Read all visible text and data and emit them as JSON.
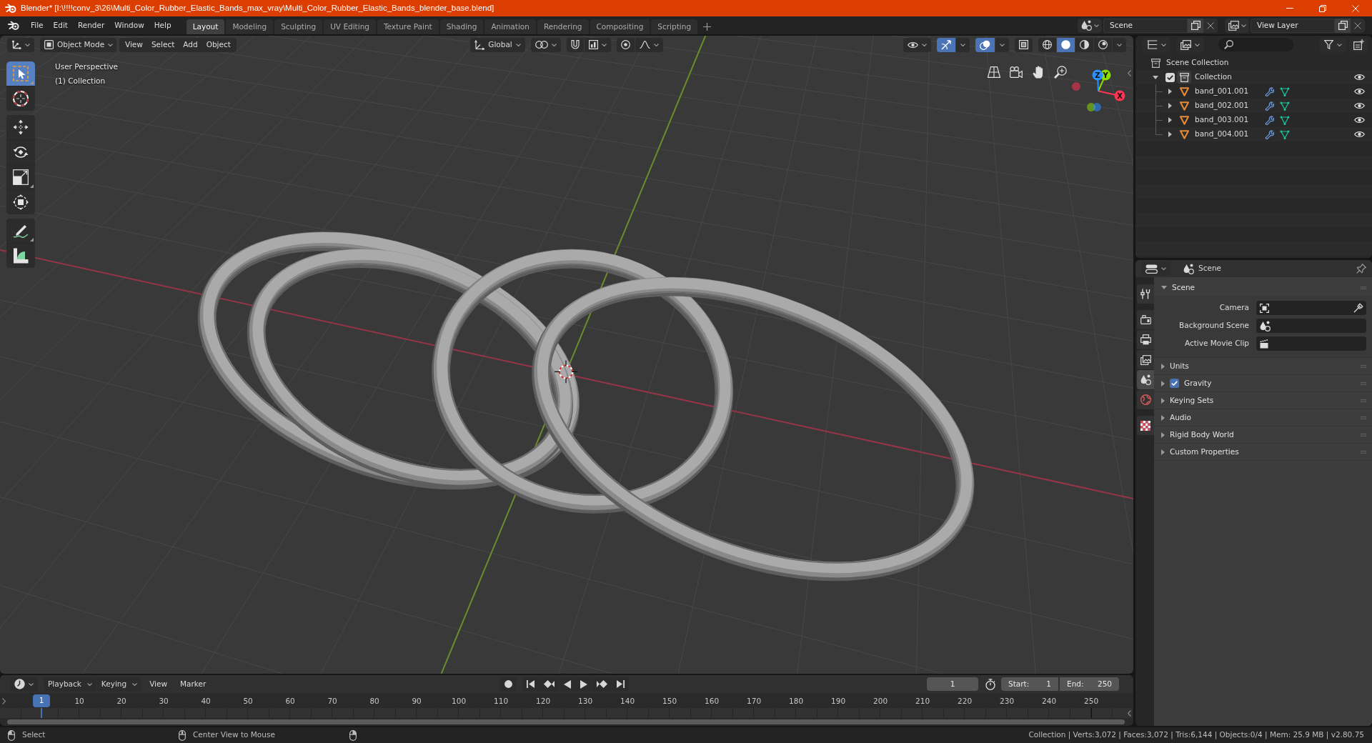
{
  "window": {
    "title": "Blender* [I:\\!!!!conv_3\\26\\Multi_Color_Rubber_Elastic_Bands_max_vray\\Multi_Color_Rubber_Elastic_Bands_blender_base.blend]"
  },
  "top_bar": {
    "menus": [
      "File",
      "Edit",
      "Render",
      "Window",
      "Help"
    ],
    "workspaces": [
      {
        "label": "Layout",
        "selected": true
      },
      {
        "label": "Modeling",
        "selected": false
      },
      {
        "label": "Sculpting",
        "selected": false
      },
      {
        "label": "UV Editing",
        "selected": false
      },
      {
        "label": "Texture Paint",
        "selected": false
      },
      {
        "label": "Shading",
        "selected": false
      },
      {
        "label": "Animation",
        "selected": false
      },
      {
        "label": "Rendering",
        "selected": false
      },
      {
        "label": "Compositing",
        "selected": false
      },
      {
        "label": "Scripting",
        "selected": false
      }
    ],
    "scene": "Scene",
    "view_layer": "View Layer"
  },
  "viewport": {
    "mode": "Object Mode",
    "menus": [
      "View",
      "Select",
      "Add",
      "Object"
    ],
    "orientation": "Global",
    "toggles": [
      {
        "kind": "gizmo",
        "on": true
      },
      {
        "kind": "overlay",
        "on": true
      },
      {
        "kind": "xray",
        "on": false
      }
    ],
    "shading": [
      {
        "kind": "wireframe",
        "selected": false
      },
      {
        "kind": "solid",
        "selected": true
      },
      {
        "kind": "material",
        "selected": false
      },
      {
        "kind": "rendered",
        "selected": false
      }
    ],
    "toolbar": [
      [
        {
          "kind": "select_box",
          "selected": true
        },
        {
          "kind": "cursor",
          "selected": false
        }
      ],
      [
        {
          "kind": "move",
          "selected": false
        },
        {
          "kind": "rotate",
          "selected": false
        },
        {
          "kind": "scale",
          "selected": false
        },
        {
          "kind": "transform",
          "selected": false
        }
      ],
      [
        {
          "kind": "annotate",
          "selected": false
        },
        {
          "kind": "measure",
          "selected": false
        }
      ]
    ],
    "info": [
      "User Perspective",
      "(1) Collection"
    ],
    "axes": [
      {
        "label": "X",
        "color": "#ff3352"
      },
      {
        "label": "Y",
        "color": "#8bdc00"
      },
      {
        "label": "Z",
        "color": "#2890ff"
      }
    ]
  },
  "outliner": {
    "root": "Scene Collection",
    "collections": [
      {
        "label": "Collection",
        "checked": true,
        "expanded": true,
        "visible": true,
        "children": [
          {
            "label": "band_001.001",
            "expanded": false,
            "visible": true
          },
          {
            "label": "band_002.001",
            "expanded": false,
            "visible": true
          },
          {
            "label": "band_003.001",
            "expanded": false,
            "visible": true
          },
          {
            "label": "band_004.001",
            "expanded": false,
            "visible": true
          }
        ]
      }
    ]
  },
  "properties": {
    "context": "Scene",
    "tabs": [
      [
        {
          "kind": "tool",
          "selected": false
        }
      ],
      [
        {
          "kind": "render",
          "selected": false
        },
        {
          "kind": "output",
          "selected": false
        },
        {
          "kind": "view_layer",
          "selected": false
        },
        {
          "kind": "scene",
          "selected": true
        },
        {
          "kind": "world",
          "selected": false
        }
      ],
      [
        {
          "kind": "texture",
          "selected": false
        }
      ]
    ],
    "panels": [
      {
        "kind": "plain",
        "label": "Scene",
        "expanded": true,
        "fields": [
          {
            "kind": "camera",
            "label": "Camera"
          },
          {
            "kind": "scene",
            "label": "Background Scene"
          },
          {
            "kind": "clip",
            "label": "Active Movie Clip"
          }
        ]
      },
      {
        "kind": "plain",
        "label": "Units",
        "expanded": false
      },
      {
        "kind": "toggle",
        "label": "Gravity",
        "expanded": false,
        "checked": true
      },
      {
        "kind": "plain",
        "label": "Keying Sets",
        "expanded": false
      },
      {
        "kind": "plain",
        "label": "Audio",
        "expanded": false
      },
      {
        "kind": "plain",
        "label": "Rigid Body World",
        "expanded": false
      },
      {
        "kind": "plain",
        "label": "Custom Properties",
        "expanded": false
      }
    ]
  },
  "timeline": {
    "menus": [
      {
        "kind": "dropdown",
        "label": "Playback"
      },
      {
        "kind": "dropdown",
        "label": "Keying"
      },
      {
        "kind": "menu",
        "label": "View"
      },
      {
        "kind": "menu",
        "label": "Marker"
      }
    ],
    "current_frame": "1",
    "start": {
      "label": "Start:",
      "value": "1"
    },
    "end": {
      "label": "End:",
      "value": "250"
    },
    "playhead": "1",
    "ticks": [
      "10",
      "20",
      "30",
      "40",
      "50",
      "60",
      "70",
      "80",
      "90",
      "100",
      "110",
      "120",
      "130",
      "140",
      "150",
      "160",
      "170",
      "180",
      "190",
      "200",
      "210",
      "220",
      "230",
      "240",
      "250"
    ]
  },
  "status_bar": {
    "hints": [
      {
        "kind": "left",
        "label": "Select"
      },
      {
        "kind": "middle",
        "label": "Center View to Mouse"
      },
      {
        "kind": "right"
      }
    ],
    "stats": "Collection | Verts:3,072 | Faces:3,072 | Tris:6,144 | Objects:0/4 | Mem: 25.9 MB | v2.80.75"
  }
}
